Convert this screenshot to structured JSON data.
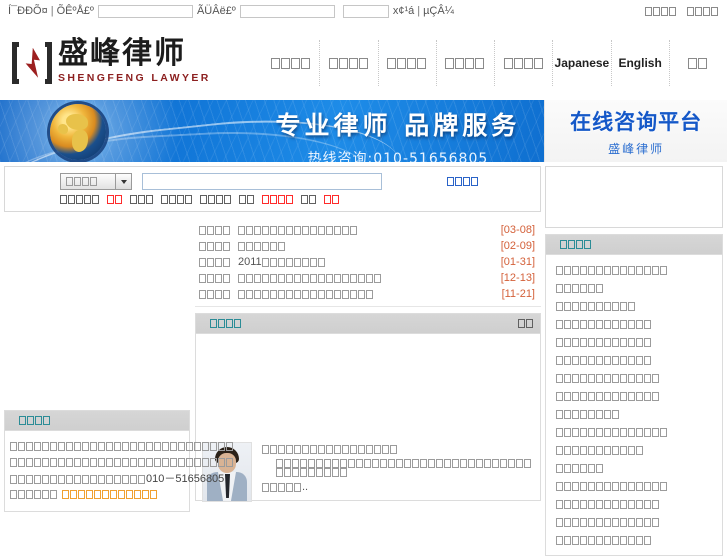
{
  "topbar": {
    "left_text_1": "Í¯ÐÐÕ¤",
    "sep": "|",
    "left_text_2": "ÕÊºÅ£º",
    "input_1_value": "",
    "left_text_3": "ÃÜÂë£º",
    "input_2_value": "",
    "input_3_value": "",
    "left_text_4": "x¢¹á",
    "left_text_5": "µÇÂ¼",
    "right_links": [
      {
        "name": "link-1",
        "boxes": 4
      },
      {
        "name": "link-2",
        "boxes": 4
      }
    ]
  },
  "logo": {
    "cn": "盛峰律师",
    "en": "SHENGFENG LAWYER"
  },
  "nav": {
    "items": [
      {
        "type": "tofu",
        "boxes": 4,
        "label": ""
      },
      {
        "type": "tofu",
        "boxes": 4,
        "label": ""
      },
      {
        "type": "tofu",
        "boxes": 4,
        "label": ""
      },
      {
        "type": "tofu",
        "boxes": 4,
        "label": ""
      },
      {
        "type": "tofu",
        "boxes": 4,
        "label": ""
      },
      {
        "type": "text",
        "boxes": 0,
        "label": "Japanese"
      },
      {
        "type": "text",
        "boxes": 0,
        "label": "English"
      },
      {
        "type": "tofu",
        "boxes": 2,
        "label": ""
      }
    ]
  },
  "banner": {
    "title": "专业律师  品牌服务",
    "subtitle": "热线咨询:010-51656805",
    "right_title": "在线咨询平台",
    "right_subtitle": "盛峰律师"
  },
  "search": {
    "category_boxes": 4,
    "input_value": "",
    "input_placeholder": "",
    "submit_boxes": 4,
    "tags": [
      {
        "boxes": 5,
        "color": "dark"
      },
      {
        "boxes": 2,
        "color": "red"
      },
      {
        "boxes": 3,
        "color": "dark"
      },
      {
        "boxes": 4,
        "color": "dark"
      },
      {
        "boxes": 4,
        "color": "dark"
      },
      {
        "boxes": 2,
        "color": "dark"
      },
      {
        "boxes": 4,
        "color": "red"
      },
      {
        "boxes": 2,
        "color": "dark"
      },
      {
        "boxes": 2,
        "color": "red"
      }
    ]
  },
  "news": {
    "items": [
      {
        "cat_boxes": 4,
        "title_boxes": 15,
        "date": "[03-08]"
      },
      {
        "cat_boxes": 4,
        "title_boxes": 6,
        "date": "[02-09]"
      },
      {
        "cat_boxes": 4,
        "title_boxes": 8,
        "prefix": "2011",
        "date": "[01-31]"
      },
      {
        "cat_boxes": 4,
        "title_boxes": 18,
        "date": "[12-13]"
      },
      {
        "cat_boxes": 4,
        "title_boxes": 17,
        "date": "[11-21]"
      }
    ]
  },
  "panel": {
    "title_boxes": 4,
    "more_boxes": 2
  },
  "intro": {
    "line1_boxes": 17,
    "line2_boxes": 41,
    "line3_boxes": 5,
    "ellipsis": ".."
  },
  "left_panel": {
    "title_boxes": 4,
    "line1_boxes": 28,
    "line2_boxes": 28,
    "line3_boxes": 17,
    "phone": "010－51656805",
    "line4_boxes": 6,
    "link_boxes": 12
  },
  "sidebar": {
    "title_boxes": 4,
    "items": [
      {
        "boxes": 14
      },
      {
        "boxes": 6
      },
      {
        "boxes": 10
      },
      {
        "boxes": 12
      },
      {
        "boxes": 12
      },
      {
        "boxes": 12
      },
      {
        "boxes": 13
      },
      {
        "boxes": 13
      },
      {
        "boxes": 8
      },
      {
        "boxes": 14
      },
      {
        "boxes": 11
      },
      {
        "boxes": 6
      },
      {
        "boxes": 14
      },
      {
        "boxes": 13
      },
      {
        "boxes": 13
      },
      {
        "boxes": 12
      }
    ]
  },
  "colors": {
    "banner_blue": "#1277d8",
    "brand_red": "#9c1f1f",
    "teal": "#2b8c96",
    "date_orange": "#d4613a",
    "link_orange": "#f0a030",
    "panel_gray": "#d2d2d2",
    "tag_red": "#ff2b2b"
  }
}
